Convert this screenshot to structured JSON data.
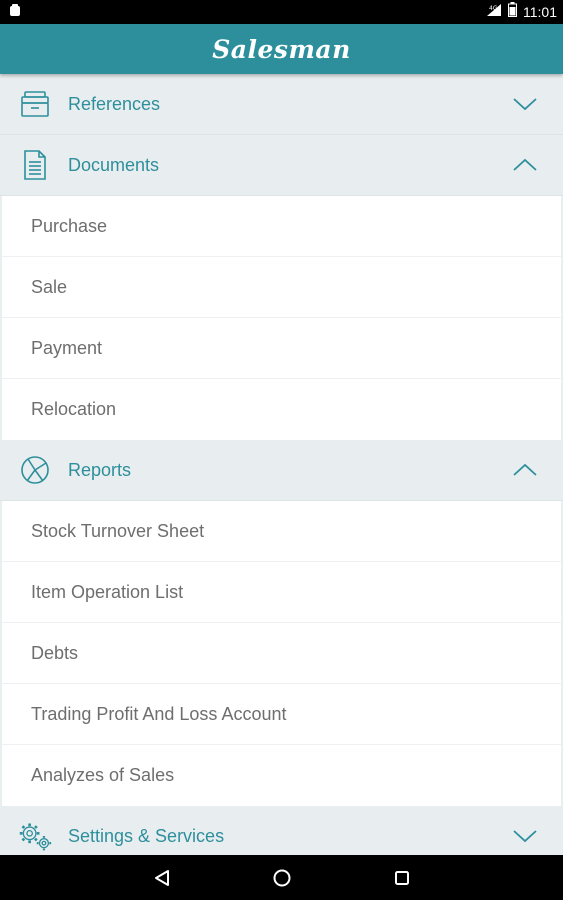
{
  "status_bar": {
    "time": "11:01",
    "icons": [
      "notification-icon",
      "signal-icon",
      "battery-icon"
    ]
  },
  "app_bar": {
    "title": "Salesman"
  },
  "sections": [
    {
      "label": "References",
      "icon": "archive-box-icon",
      "expanded": false,
      "items": []
    },
    {
      "label": "Documents",
      "icon": "document-icon",
      "expanded": true,
      "items": [
        "Purchase",
        "Sale",
        "Payment",
        "Relocation"
      ]
    },
    {
      "label": "Reports",
      "icon": "pie-chart-icon",
      "expanded": true,
      "items": [
        "Stock Turnover Sheet",
        "Item Operation List",
        "Debts",
        "Trading Profit And Loss Account",
        "Analyzes of Sales"
      ]
    },
    {
      "label": "Settings & Services",
      "icon": "gears-icon",
      "expanded": false,
      "items": []
    }
  ],
  "nav_bar": {
    "buttons": [
      "back-icon",
      "home-icon",
      "recents-icon"
    ]
  },
  "colors": {
    "accent": "#2e8f9c",
    "header_bg": "#e8eef0",
    "item_text": "#6e6e6e"
  }
}
